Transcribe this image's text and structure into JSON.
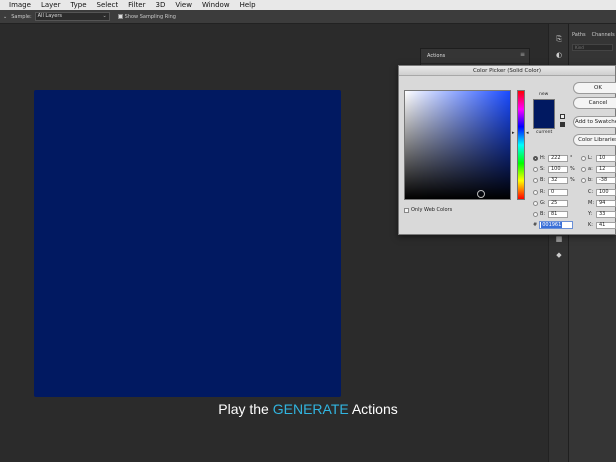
{
  "menubar": [
    "Image",
    "Layer",
    "Type",
    "Select",
    "Filter",
    "3D",
    "View",
    "Window",
    "Help"
  ],
  "options_bar": {
    "sample_label": "Sample:",
    "sample_value": "All Layers",
    "show_ring_label": "Show Sampling Ring"
  },
  "canvas": {
    "color": "#011961"
  },
  "caption": {
    "prefix": "Play the ",
    "highlight": "GENERATE",
    "suffix": " Actions"
  },
  "actions_panel": {
    "title": "Actions"
  },
  "side_panel": {
    "tab_paths": "Paths",
    "tab_channels": "Channels",
    "search_placeholder": "Kind"
  },
  "color_picker": {
    "title": "Color Picker (Solid Color)",
    "new_label": "new",
    "current_label": "current",
    "ok": "OK",
    "cancel": "Cancel",
    "add_to_swatches": "Add to Swatches",
    "color_libraries": "Color Libraries",
    "only_web_colors": "Only Web Colors",
    "hsb": [
      {
        "label": "H:",
        "value": "222",
        "unit": "°"
      },
      {
        "label": "S:",
        "value": "100",
        "unit": "%"
      },
      {
        "label": "B:",
        "value": "32",
        "unit": "%"
      }
    ],
    "rgb": [
      {
        "label": "R:",
        "value": "0"
      },
      {
        "label": "G:",
        "value": "25"
      },
      {
        "label": "B:",
        "value": "81"
      }
    ],
    "lab": [
      {
        "label": "L:",
        "value": "10"
      },
      {
        "label": "a:",
        "value": "12"
      },
      {
        "label": "b:",
        "value": "-38"
      }
    ],
    "cmyk": [
      {
        "label": "C:",
        "value": "100",
        "unit": "%"
      },
      {
        "label": "M:",
        "value": "94",
        "unit": "%"
      },
      {
        "label": "Y:",
        "value": "33",
        "unit": "%"
      },
      {
        "label": "K:",
        "value": "41",
        "unit": "%"
      }
    ],
    "hex_label": "#",
    "hex": "001961",
    "new_color": "#011961",
    "current_color": "#011961"
  }
}
